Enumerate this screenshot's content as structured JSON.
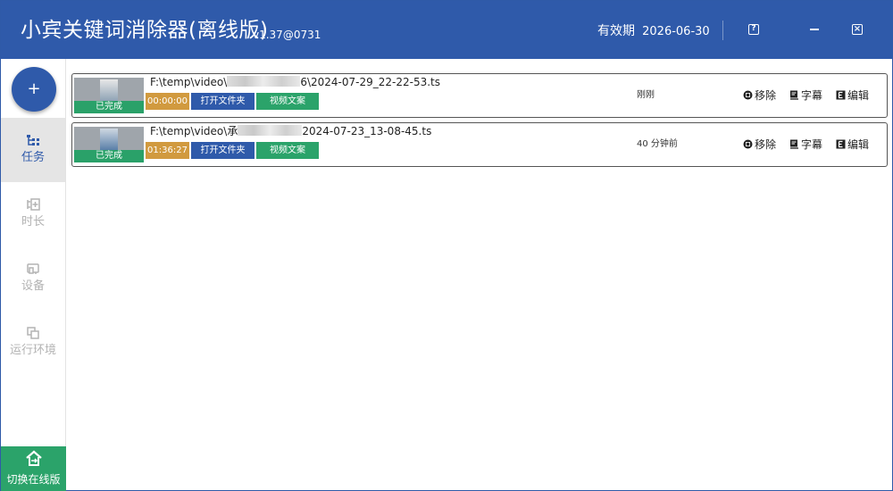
{
  "app": {
    "title": "小宾关键词消除器(离线版)",
    "version": "v1.37@0731",
    "validity_label": "有效期",
    "validity_date": "2026-06-30",
    "help_glyph": "?",
    "close_glyph": "×",
    "accent_color": "#2f5aaa"
  },
  "sidebar": {
    "add_glyph": "+",
    "items": [
      {
        "label": "任务",
        "icon": "task-list-icon",
        "active": true
      },
      {
        "label": "时长",
        "icon": "duration-icon",
        "active": false
      },
      {
        "label": "设备",
        "icon": "device-icon",
        "active": false
      },
      {
        "label": "运行环境",
        "icon": "environment-icon",
        "active": false
      }
    ],
    "switch_label": "切换在线版"
  },
  "tasks": [
    {
      "status": "已完成",
      "path_prefix": "F:\\temp\\video\\",
      "path_tail_pre": "6",
      "path_suffix": "\\2024-07-29_22-22-53.ts",
      "duration": "00:00:00",
      "open_folder": "打开文件夹",
      "video_text": "视频文案",
      "time_ago": "刚刚",
      "remove": "移除",
      "subtitle": "字幕",
      "edit": "编辑"
    },
    {
      "status": "已完成",
      "path_prefix": "F:\\temp\\video\\",
      "path_tail_pre": "承",
      "path_suffix": "2024-07-23_13-08-45.ts",
      "duration": "01:36:27",
      "open_folder": "打开文件夹",
      "video_text": "视频文案",
      "time_ago": "40 分钟前",
      "remove": "移除",
      "subtitle": "字幕",
      "edit": "编辑"
    }
  ]
}
